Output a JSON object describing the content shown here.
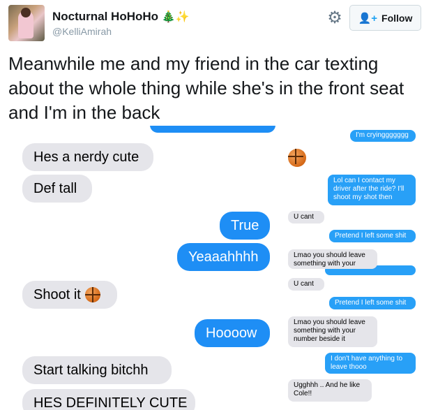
{
  "header": {
    "display_name": "Nocturnal HoHoHo",
    "name_emojis": "🎄✨",
    "handle": "@KelliAmirah",
    "follow_label": "Follow"
  },
  "tweet": {
    "text": "Meanwhile me and my friend in the car texting about the whole thing while she's in the front seat and I'm in the back"
  },
  "left_chat": {
    "received": [
      "Hes a nerdy cute",
      "Def tall",
      "Shoot it",
      "Start talking bitchh",
      "HES DEFINITELY CUTE"
    ],
    "sent": [
      "True",
      "Yeaaahhhh",
      "Hoooow"
    ]
  },
  "right_chat": {
    "sent": [
      "I'm cryinggggggg",
      "Lol can I contact my driver after the ride? I'll shoot my shot then",
      "Pretend I left some shit",
      "Pretend I left some shit",
      "I don't have anything to leave thooo"
    ],
    "received": [
      "U cant",
      "Lmao you should leave something with your",
      "U cant",
      "Lmao you should leave something with your number beside it",
      "Ugghhh .. And he like Cole!!"
    ]
  },
  "icons": [
    "gear-icon",
    "add-person-icon",
    "basketball-icon"
  ]
}
